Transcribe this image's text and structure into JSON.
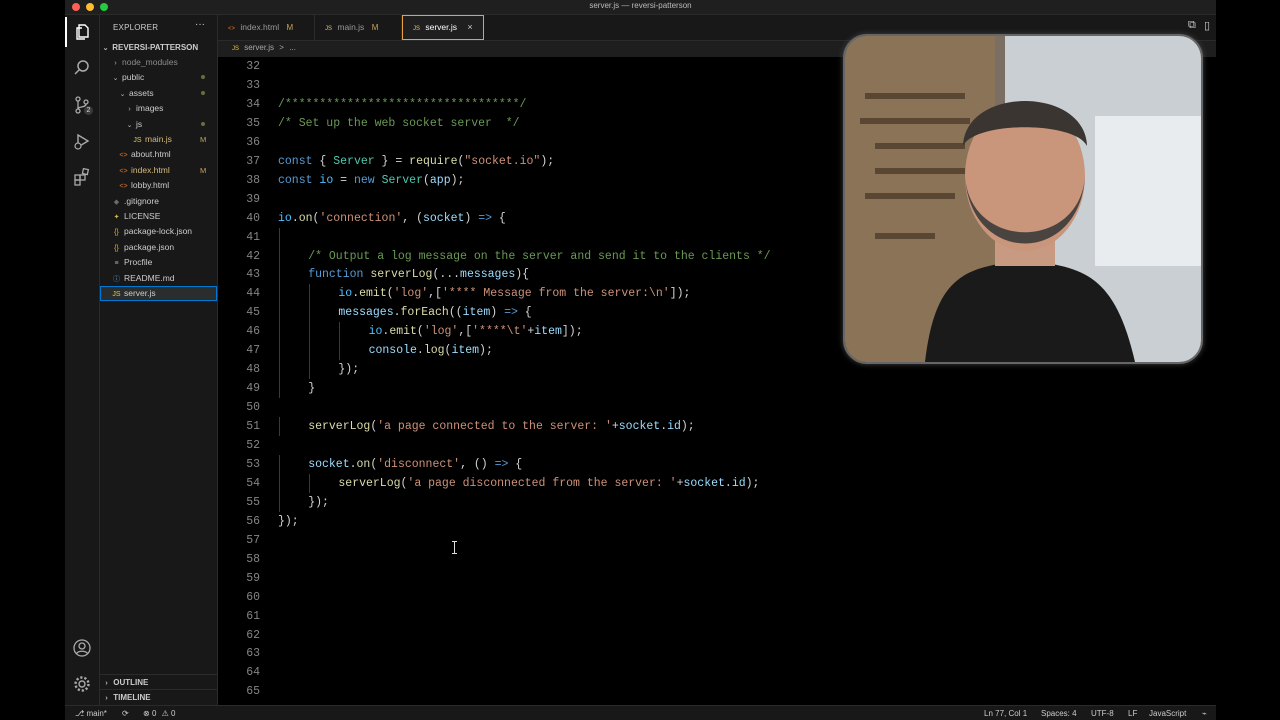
{
  "window": {
    "title": "server.js — reversi-patterson"
  },
  "activity_bar": {
    "source_control_badge": "2"
  },
  "explorer": {
    "header": "EXPLORER",
    "more": "···",
    "project": "REVERSI-PATTERSON",
    "items": [
      {
        "label": "node_modules",
        "indent": 1,
        "kind": "folder",
        "open": false,
        "status": "",
        "dimmed": true
      },
      {
        "label": "public",
        "indent": 1,
        "kind": "folder",
        "open": true,
        "status": "dot"
      },
      {
        "label": "assets",
        "indent": 2,
        "kind": "folder",
        "open": true,
        "status": "dot"
      },
      {
        "label": "images",
        "indent": 3,
        "kind": "folder",
        "open": false,
        "status": ""
      },
      {
        "label": "js",
        "indent": 3,
        "kind": "folder",
        "open": true,
        "status": "dot"
      },
      {
        "label": "main.js",
        "indent": 4,
        "kind": "js",
        "status": "M"
      },
      {
        "label": "about.html",
        "indent": 2,
        "kind": "html",
        "status": ""
      },
      {
        "label": "index.html",
        "indent": 2,
        "kind": "html",
        "status": "M"
      },
      {
        "label": "lobby.html",
        "indent": 2,
        "kind": "html",
        "status": ""
      },
      {
        "label": ".gitignore",
        "indent": 1,
        "kind": "git",
        "status": ""
      },
      {
        "label": "LICENSE",
        "indent": 1,
        "kind": "license",
        "status": ""
      },
      {
        "label": "package-lock.json",
        "indent": 1,
        "kind": "json",
        "status": ""
      },
      {
        "label": "package.json",
        "indent": 1,
        "kind": "json",
        "status": ""
      },
      {
        "label": "Procfile",
        "indent": 1,
        "kind": "file",
        "status": ""
      },
      {
        "label": "README.md",
        "indent": 1,
        "kind": "md",
        "status": ""
      },
      {
        "label": "server.js",
        "indent": 1,
        "kind": "js",
        "status": "",
        "selected": true
      }
    ],
    "outline": "OUTLINE",
    "timeline": "TIMELINE"
  },
  "tabs": [
    {
      "icon": "<>",
      "label": "index.html",
      "status": "M",
      "active": false
    },
    {
      "icon": "JS",
      "label": "main.js",
      "status": "M",
      "active": false
    },
    {
      "icon": "JS",
      "label": "server.js",
      "status": "×",
      "active": true
    }
  ],
  "breadcrumb": {
    "icon": "JS",
    "file": "server.js",
    "sep": ">",
    "rest": "..."
  },
  "code": {
    "lines": [
      {
        "n": "32",
        "indent": 0,
        "tokens": []
      },
      {
        "n": "33",
        "indent": 0,
        "tokens": []
      },
      {
        "n": "34",
        "indent": 0,
        "tokens": [
          {
            "t": "/**********************************/",
            "c": "#6a9955"
          }
        ]
      },
      {
        "n": "35",
        "indent": 0,
        "tokens": [
          {
            "t": "/* Set up the web socket server  */",
            "c": "#6a9955"
          }
        ]
      },
      {
        "n": "36",
        "indent": 0,
        "tokens": []
      },
      {
        "n": "37",
        "indent": 0,
        "tokens": [
          {
            "t": "const",
            "c": "#569cd6"
          },
          {
            "t": " { ",
            "c": "#d4d4d4"
          },
          {
            "t": "Server",
            "c": "#4ec9b0"
          },
          {
            "t": " } = ",
            "c": "#d4d4d4"
          },
          {
            "t": "require",
            "c": "#dcdcaa"
          },
          {
            "t": "(",
            "c": "#d4d4d4"
          },
          {
            "t": "\"socket.io\"",
            "c": "#ce9178"
          },
          {
            "t": ");",
            "c": "#d4d4d4"
          }
        ]
      },
      {
        "n": "38",
        "indent": 0,
        "tokens": [
          {
            "t": "const",
            "c": "#569cd6"
          },
          {
            "t": " ",
            "c": "#d4d4d4"
          },
          {
            "t": "io",
            "c": "#4fc1ff"
          },
          {
            "t": " = ",
            "c": "#d4d4d4"
          },
          {
            "t": "new",
            "c": "#569cd6"
          },
          {
            "t": " ",
            "c": "#d4d4d4"
          },
          {
            "t": "Server",
            "c": "#4ec9b0"
          },
          {
            "t": "(",
            "c": "#d4d4d4"
          },
          {
            "t": "app",
            "c": "#9cdcfe"
          },
          {
            "t": ");",
            "c": "#d4d4d4"
          }
        ]
      },
      {
        "n": "39",
        "indent": 0,
        "tokens": []
      },
      {
        "n": "40",
        "indent": 0,
        "tokens": [
          {
            "t": "io",
            "c": "#4fc1ff"
          },
          {
            "t": ".",
            "c": "#d4d4d4"
          },
          {
            "t": "on",
            "c": "#dcdcaa"
          },
          {
            "t": "(",
            "c": "#d4d4d4"
          },
          {
            "t": "'connection'",
            "c": "#ce9178"
          },
          {
            "t": ", (",
            "c": "#d4d4d4"
          },
          {
            "t": "socket",
            "c": "#9cdcfe"
          },
          {
            "t": ") ",
            "c": "#d4d4d4"
          },
          {
            "t": "=>",
            "c": "#569cd6"
          },
          {
            "t": " {",
            "c": "#d4d4d4"
          }
        ]
      },
      {
        "n": "41",
        "indent": 1,
        "tokens": []
      },
      {
        "n": "42",
        "indent": 1,
        "tokens": [
          {
            "t": "/* Output a log message on the server and send it to the clients */",
            "c": "#6a9955"
          }
        ]
      },
      {
        "n": "43",
        "indent": 1,
        "tokens": [
          {
            "t": "function",
            "c": "#569cd6"
          },
          {
            "t": " ",
            "c": "#d4d4d4"
          },
          {
            "t": "serverLog",
            "c": "#dcdcaa"
          },
          {
            "t": "(...",
            "c": "#d4d4d4"
          },
          {
            "t": "messages",
            "c": "#9cdcfe"
          },
          {
            "t": "){",
            "c": "#d4d4d4"
          }
        ]
      },
      {
        "n": "44",
        "indent": 2,
        "tokens": [
          {
            "t": "io",
            "c": "#4fc1ff"
          },
          {
            "t": ".",
            "c": "#d4d4d4"
          },
          {
            "t": "emit",
            "c": "#dcdcaa"
          },
          {
            "t": "(",
            "c": "#d4d4d4"
          },
          {
            "t": "'log'",
            "c": "#ce9178"
          },
          {
            "t": ",[",
            "c": "#d4d4d4"
          },
          {
            "t": "'**** Message from the server:\\n'",
            "c": "#ce9178"
          },
          {
            "t": "]);",
            "c": "#d4d4d4"
          }
        ]
      },
      {
        "n": "45",
        "indent": 2,
        "tokens": [
          {
            "t": "messages",
            "c": "#9cdcfe"
          },
          {
            "t": ".",
            "c": "#d4d4d4"
          },
          {
            "t": "forEach",
            "c": "#dcdcaa"
          },
          {
            "t": "((",
            "c": "#d4d4d4"
          },
          {
            "t": "item",
            "c": "#9cdcfe"
          },
          {
            "t": ") ",
            "c": "#d4d4d4"
          },
          {
            "t": "=>",
            "c": "#569cd6"
          },
          {
            "t": " {",
            "c": "#d4d4d4"
          }
        ]
      },
      {
        "n": "46",
        "indent": 3,
        "tokens": [
          {
            "t": "io",
            "c": "#4fc1ff"
          },
          {
            "t": ".",
            "c": "#d4d4d4"
          },
          {
            "t": "emit",
            "c": "#dcdcaa"
          },
          {
            "t": "(",
            "c": "#d4d4d4"
          },
          {
            "t": "'log'",
            "c": "#ce9178"
          },
          {
            "t": ",[",
            "c": "#d4d4d4"
          },
          {
            "t": "'****\\t'",
            "c": "#ce9178"
          },
          {
            "t": "+",
            "c": "#d4d4d4"
          },
          {
            "t": "item",
            "c": "#9cdcfe"
          },
          {
            "t": "]);",
            "c": "#d4d4d4"
          }
        ]
      },
      {
        "n": "47",
        "indent": 3,
        "tokens": [
          {
            "t": "console",
            "c": "#9cdcfe"
          },
          {
            "t": ".",
            "c": "#d4d4d4"
          },
          {
            "t": "log",
            "c": "#dcdcaa"
          },
          {
            "t": "(",
            "c": "#d4d4d4"
          },
          {
            "t": "item",
            "c": "#9cdcfe"
          },
          {
            "t": ");",
            "c": "#d4d4d4"
          }
        ]
      },
      {
        "n": "48",
        "indent": 2,
        "tokens": [
          {
            "t": "});",
            "c": "#d4d4d4"
          }
        ]
      },
      {
        "n": "49",
        "indent": 1,
        "tokens": [
          {
            "t": "}",
            "c": "#d4d4d4"
          }
        ]
      },
      {
        "n": "50",
        "indent": 0,
        "tokens": []
      },
      {
        "n": "51",
        "indent": 1,
        "tokens": [
          {
            "t": "serverLog",
            "c": "#dcdcaa"
          },
          {
            "t": "(",
            "c": "#d4d4d4"
          },
          {
            "t": "'a page connected to the server: '",
            "c": "#ce9178"
          },
          {
            "t": "+",
            "c": "#d4d4d4"
          },
          {
            "t": "socket",
            "c": "#9cdcfe"
          },
          {
            "t": ".",
            "c": "#d4d4d4"
          },
          {
            "t": "id",
            "c": "#9cdcfe"
          },
          {
            "t": ");",
            "c": "#d4d4d4"
          }
        ]
      },
      {
        "n": "52",
        "indent": 0,
        "tokens": []
      },
      {
        "n": "53",
        "indent": 1,
        "tokens": [
          {
            "t": "socket",
            "c": "#9cdcfe"
          },
          {
            "t": ".",
            "c": "#d4d4d4"
          },
          {
            "t": "on",
            "c": "#dcdcaa"
          },
          {
            "t": "(",
            "c": "#d4d4d4"
          },
          {
            "t": "'disconnect'",
            "c": "#ce9178"
          },
          {
            "t": ", () ",
            "c": "#d4d4d4"
          },
          {
            "t": "=>",
            "c": "#569cd6"
          },
          {
            "t": " {",
            "c": "#d4d4d4"
          }
        ]
      },
      {
        "n": "54",
        "indent": 2,
        "tokens": [
          {
            "t": "serverLog",
            "c": "#dcdcaa"
          },
          {
            "t": "(",
            "c": "#d4d4d4"
          },
          {
            "t": "'a page disconnected from the server: '",
            "c": "#ce9178"
          },
          {
            "t": "+",
            "c": "#d4d4d4"
          },
          {
            "t": "socket",
            "c": "#9cdcfe"
          },
          {
            "t": ".",
            "c": "#d4d4d4"
          },
          {
            "t": "id",
            "c": "#9cdcfe"
          },
          {
            "t": ");",
            "c": "#d4d4d4"
          }
        ]
      },
      {
        "n": "55",
        "indent": 1,
        "tokens": [
          {
            "t": "});",
            "c": "#d4d4d4"
          }
        ]
      },
      {
        "n": "56",
        "indent": 0,
        "tokens": [
          {
            "t": "});",
            "c": "#d4d4d4"
          }
        ]
      },
      {
        "n": "57",
        "indent": 0,
        "tokens": []
      },
      {
        "n": "58",
        "indent": 0,
        "tokens": []
      },
      {
        "n": "59",
        "indent": 0,
        "tokens": []
      },
      {
        "n": "60",
        "indent": 0,
        "tokens": []
      },
      {
        "n": "61",
        "indent": 0,
        "tokens": []
      },
      {
        "n": "62",
        "indent": 0,
        "tokens": []
      },
      {
        "n": "63",
        "indent": 0,
        "tokens": []
      },
      {
        "n": "64",
        "indent": 0,
        "tokens": []
      },
      {
        "n": "65",
        "indent": 0,
        "tokens": []
      }
    ]
  },
  "status_bar": {
    "branch": "main*",
    "errors": "0",
    "warnings": "0",
    "position": "Ln 77, Col 1",
    "spaces": "Spaces: 4",
    "encoding": "UTF-8",
    "eol": "LF",
    "language": "JavaScript"
  },
  "colors": {
    "accent": "#0078d4",
    "modified": "#c5a45a",
    "active_tab_border": "#e8a043"
  }
}
